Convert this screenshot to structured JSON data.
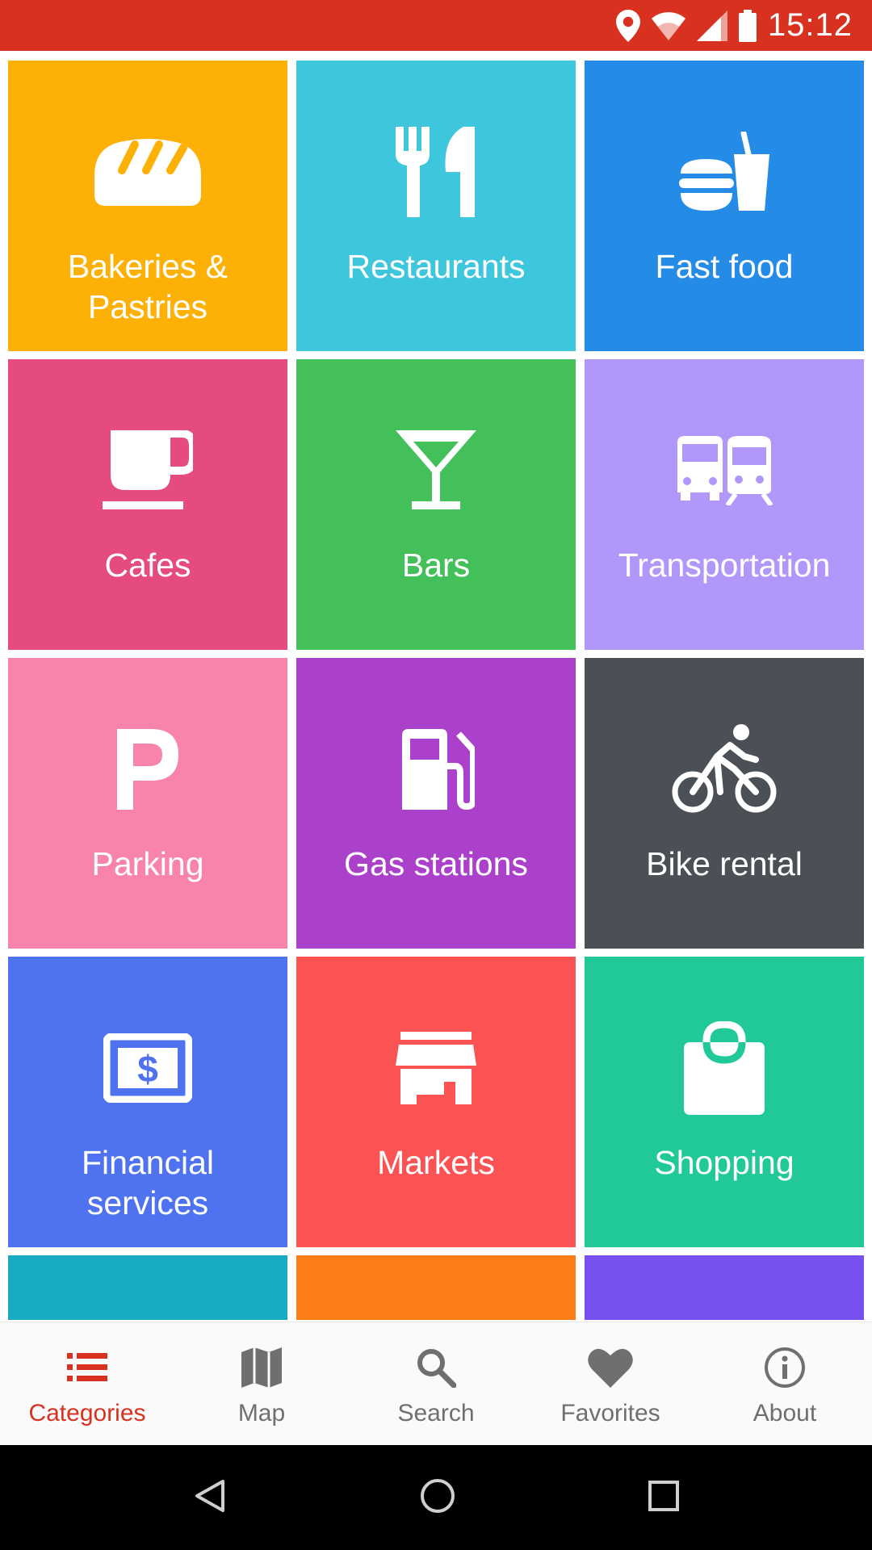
{
  "status_bar": {
    "time": "15:12",
    "background": "#d9311f",
    "icons": [
      "location-icon",
      "wifi-icon",
      "signal-icon",
      "battery-icon"
    ]
  },
  "categories": [
    {
      "label": "Bakeries &\nPastries",
      "color": "#fdb107",
      "icon": "bread-icon"
    },
    {
      "label": "Restaurants",
      "color": "#3ec7dc",
      "icon": "fork-knife-icon"
    },
    {
      "label": "Fast food",
      "color": "#248ce6",
      "icon": "burger-drink-icon"
    },
    {
      "label": "Cafes",
      "color": "#e54a80",
      "icon": "coffee-cup-icon"
    },
    {
      "label": "Bars",
      "color": "#43c05a",
      "icon": "cocktail-icon"
    },
    {
      "label": "Transportation",
      "color": "#b197fa",
      "icon": "bus-train-icon"
    },
    {
      "label": "Parking",
      "color": "#f883ab",
      "icon": "parking-icon"
    },
    {
      "label": "Gas stations",
      "color": "#ab40cb",
      "icon": "gas-pump-icon"
    },
    {
      "label": "Bike rental",
      "color": "#4b5057",
      "icon": "bicycle-icon"
    },
    {
      "label": "Financial\nservices",
      "color": "#4f72f1",
      "icon": "money-icon"
    },
    {
      "label": "Markets",
      "color": "#fb5253",
      "icon": "store-icon"
    },
    {
      "label": "Shopping",
      "color": "#22c998",
      "icon": "shopping-bag-icon"
    },
    {
      "label": "",
      "color": "#17abc2",
      "icon": ""
    },
    {
      "label": "",
      "color": "#fd7e17",
      "icon": ""
    },
    {
      "label": "",
      "color": "#7850f0",
      "icon": ""
    }
  ],
  "bottom_nav": {
    "active_color": "#d9311f",
    "items": [
      {
        "label": "Categories",
        "icon": "list-icon",
        "active": true
      },
      {
        "label": "Map",
        "icon": "map-icon",
        "active": false
      },
      {
        "label": "Search",
        "icon": "search-icon",
        "active": false
      },
      {
        "label": "Favorites",
        "icon": "heart-icon",
        "active": false
      },
      {
        "label": "About",
        "icon": "info-icon",
        "active": false
      }
    ]
  },
  "system_nav": {
    "icons": [
      "back-icon",
      "home-icon",
      "recents-icon"
    ]
  }
}
